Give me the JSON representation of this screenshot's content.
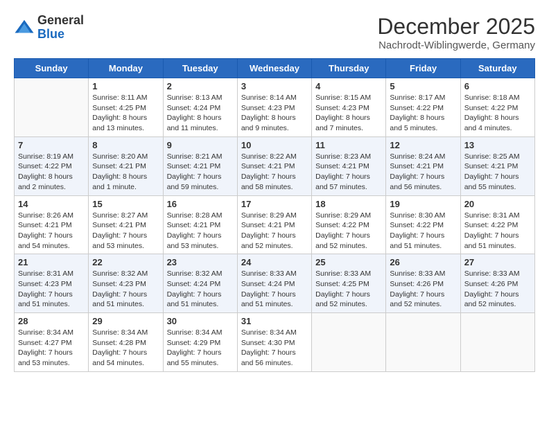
{
  "logo": {
    "general": "General",
    "blue": "Blue"
  },
  "header": {
    "month": "December 2025",
    "location": "Nachrodt-Wiblingwerde, Germany"
  },
  "weekdays": [
    "Sunday",
    "Monday",
    "Tuesday",
    "Wednesday",
    "Thursday",
    "Friday",
    "Saturday"
  ],
  "weeks": [
    [
      {
        "day": "",
        "info": ""
      },
      {
        "day": "1",
        "info": "Sunrise: 8:11 AM\nSunset: 4:25 PM\nDaylight: 8 hours\nand 13 minutes."
      },
      {
        "day": "2",
        "info": "Sunrise: 8:13 AM\nSunset: 4:24 PM\nDaylight: 8 hours\nand 11 minutes."
      },
      {
        "day": "3",
        "info": "Sunrise: 8:14 AM\nSunset: 4:23 PM\nDaylight: 8 hours\nand 9 minutes."
      },
      {
        "day": "4",
        "info": "Sunrise: 8:15 AM\nSunset: 4:23 PM\nDaylight: 8 hours\nand 7 minutes."
      },
      {
        "day": "5",
        "info": "Sunrise: 8:17 AM\nSunset: 4:22 PM\nDaylight: 8 hours\nand 5 minutes."
      },
      {
        "day": "6",
        "info": "Sunrise: 8:18 AM\nSunset: 4:22 PM\nDaylight: 8 hours\nand 4 minutes."
      }
    ],
    [
      {
        "day": "7",
        "info": "Sunrise: 8:19 AM\nSunset: 4:22 PM\nDaylight: 8 hours\nand 2 minutes."
      },
      {
        "day": "8",
        "info": "Sunrise: 8:20 AM\nSunset: 4:21 PM\nDaylight: 8 hours\nand 1 minute."
      },
      {
        "day": "9",
        "info": "Sunrise: 8:21 AM\nSunset: 4:21 PM\nDaylight: 7 hours\nand 59 minutes."
      },
      {
        "day": "10",
        "info": "Sunrise: 8:22 AM\nSunset: 4:21 PM\nDaylight: 7 hours\nand 58 minutes."
      },
      {
        "day": "11",
        "info": "Sunrise: 8:23 AM\nSunset: 4:21 PM\nDaylight: 7 hours\nand 57 minutes."
      },
      {
        "day": "12",
        "info": "Sunrise: 8:24 AM\nSunset: 4:21 PM\nDaylight: 7 hours\nand 56 minutes."
      },
      {
        "day": "13",
        "info": "Sunrise: 8:25 AM\nSunset: 4:21 PM\nDaylight: 7 hours\nand 55 minutes."
      }
    ],
    [
      {
        "day": "14",
        "info": "Sunrise: 8:26 AM\nSunset: 4:21 PM\nDaylight: 7 hours\nand 54 minutes."
      },
      {
        "day": "15",
        "info": "Sunrise: 8:27 AM\nSunset: 4:21 PM\nDaylight: 7 hours\nand 53 minutes."
      },
      {
        "day": "16",
        "info": "Sunrise: 8:28 AM\nSunset: 4:21 PM\nDaylight: 7 hours\nand 53 minutes."
      },
      {
        "day": "17",
        "info": "Sunrise: 8:29 AM\nSunset: 4:21 PM\nDaylight: 7 hours\nand 52 minutes."
      },
      {
        "day": "18",
        "info": "Sunrise: 8:29 AM\nSunset: 4:22 PM\nDaylight: 7 hours\nand 52 minutes."
      },
      {
        "day": "19",
        "info": "Sunrise: 8:30 AM\nSunset: 4:22 PM\nDaylight: 7 hours\nand 51 minutes."
      },
      {
        "day": "20",
        "info": "Sunrise: 8:31 AM\nSunset: 4:22 PM\nDaylight: 7 hours\nand 51 minutes."
      }
    ],
    [
      {
        "day": "21",
        "info": "Sunrise: 8:31 AM\nSunset: 4:23 PM\nDaylight: 7 hours\nand 51 minutes."
      },
      {
        "day": "22",
        "info": "Sunrise: 8:32 AM\nSunset: 4:23 PM\nDaylight: 7 hours\nand 51 minutes."
      },
      {
        "day": "23",
        "info": "Sunrise: 8:32 AM\nSunset: 4:24 PM\nDaylight: 7 hours\nand 51 minutes."
      },
      {
        "day": "24",
        "info": "Sunrise: 8:33 AM\nSunset: 4:24 PM\nDaylight: 7 hours\nand 51 minutes."
      },
      {
        "day": "25",
        "info": "Sunrise: 8:33 AM\nSunset: 4:25 PM\nDaylight: 7 hours\nand 52 minutes."
      },
      {
        "day": "26",
        "info": "Sunrise: 8:33 AM\nSunset: 4:26 PM\nDaylight: 7 hours\nand 52 minutes."
      },
      {
        "day": "27",
        "info": "Sunrise: 8:33 AM\nSunset: 4:26 PM\nDaylight: 7 hours\nand 52 minutes."
      }
    ],
    [
      {
        "day": "28",
        "info": "Sunrise: 8:34 AM\nSunset: 4:27 PM\nDaylight: 7 hours\nand 53 minutes."
      },
      {
        "day": "29",
        "info": "Sunrise: 8:34 AM\nSunset: 4:28 PM\nDaylight: 7 hours\nand 54 minutes."
      },
      {
        "day": "30",
        "info": "Sunrise: 8:34 AM\nSunset: 4:29 PM\nDaylight: 7 hours\nand 55 minutes."
      },
      {
        "day": "31",
        "info": "Sunrise: 8:34 AM\nSunset: 4:30 PM\nDaylight: 7 hours\nand 56 minutes."
      },
      {
        "day": "",
        "info": ""
      },
      {
        "day": "",
        "info": ""
      },
      {
        "day": "",
        "info": ""
      }
    ]
  ]
}
